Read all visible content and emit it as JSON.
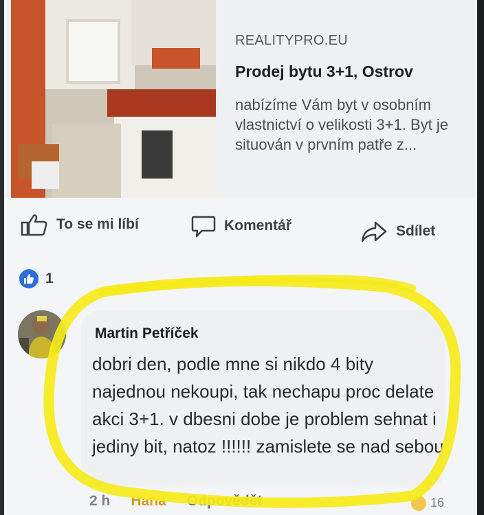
{
  "link_preview": {
    "domain": "REALITYPRO.EU",
    "title": "Prodej bytu 3+1, Ostrov",
    "description": "nabízíme Vám byt v osobním vlastnictví o velikosti 3+1. Byt je situován v prvním patře z..."
  },
  "actions": {
    "like": "To se mi líbí",
    "comment": "Komentář",
    "share": "Sdílet"
  },
  "reactions": {
    "count": "1"
  },
  "comment": {
    "author": "Martin Petříček",
    "text": "dobri den, podle mne si nikdo 4 bity najednou nekoupi, tak nechapu proc delate akci 3+1. v dbesni dobe je problem sehnat i jediny bit, natoz !!!!!! zamislete se nad sebou",
    "time": "2 h",
    "reaction_label": "Haha",
    "reply_label": "Odpovědět",
    "reaction_count": "16"
  },
  "colors": {
    "accent_blue": "#2d6fd6",
    "highlight_yellow": "#f5ea1a"
  }
}
